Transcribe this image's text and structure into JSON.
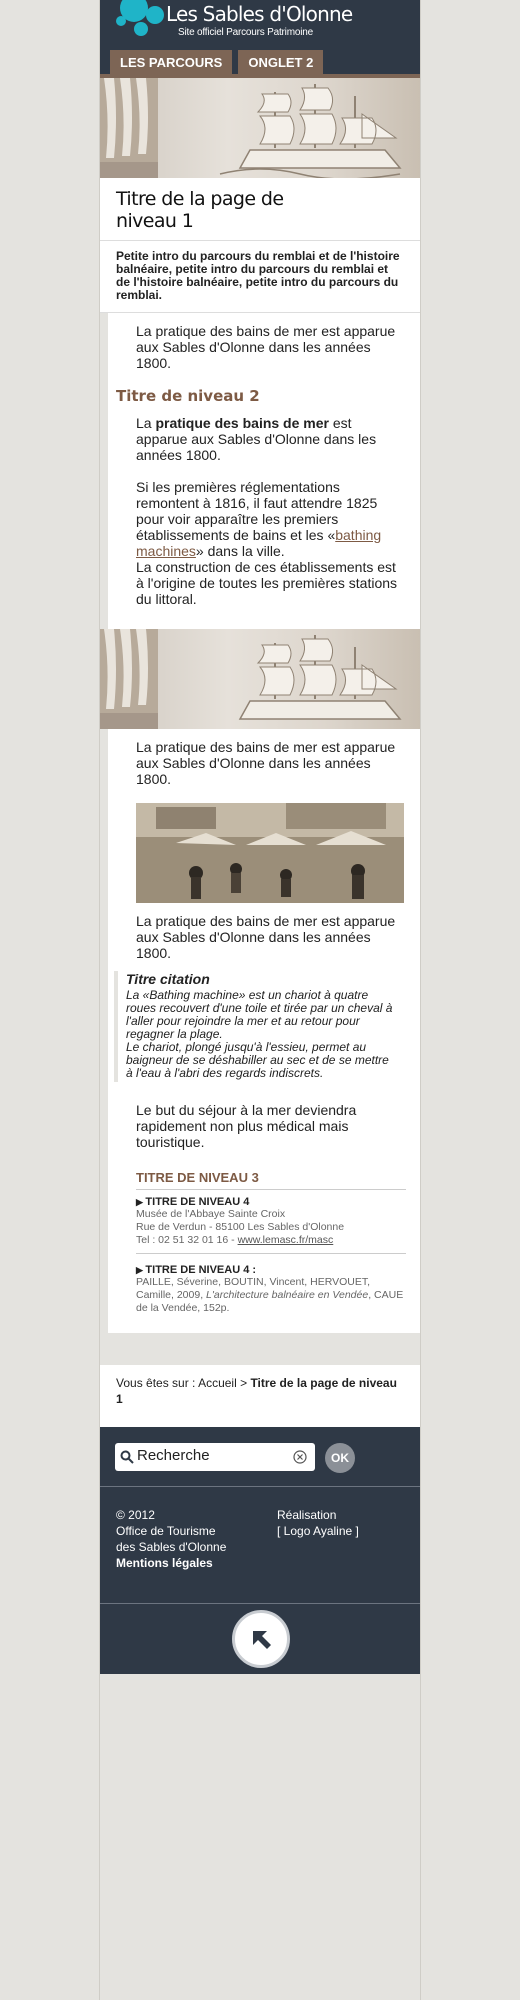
{
  "header": {
    "logo_title": "Les Sables d'Olonne",
    "logo_subtitle": "Site officiel Parcours Patrimoine",
    "tabs": [
      "LES PARCOURS",
      "ONGLET 2"
    ]
  },
  "page": {
    "title": "Titre de la page de niveau 1",
    "intro": "Petite intro du parcours du remblai et de l'histoire balnéaire, petite intro du parcours du remblai et de l'histoire balnéaire, petite intro du parcours du remblai."
  },
  "content": {
    "p1": "La pratique des bains de mer est apparue aux Sables d'Olonne dans les années 1800.",
    "h2": "Titre de niveau 2",
    "p2_prefix": "La ",
    "p2_bold": "pratique des bains de mer",
    "p2_suffix": " est apparue aux Sables d'Olonne dans les années 1800.",
    "p3_a": "Si les premières réglementations remontent à 1816, il faut attendre 1825 pour voir apparaître les premiers établissements de bains et les «",
    "p3_link": "bathing machines",
    "p3_b": "» dans la ville.",
    "p3_c": "La construction de ces établissements est à l'origine de toutes les premières stations du littoral.",
    "p4": "La pratique des bains de mer est apparue aux Sables d'Olonne dans les années 1800.",
    "p5": "La pratique des bains de mer est apparue aux Sables d'Olonne dans les années 1800.",
    "citation_title": "Titre citation",
    "citation_1": "La «Bathing machine» est un chariot à quatre roues recouvert d'une toile et tirée par un cheval à l'aller pour rejoindre la mer et au retour pour regagner la plage.",
    "citation_2": "Le chariot, plongé jusqu'à l'essieu, permet au baigneur de se déshabiller au sec et de se mettre à l'eau à l'abri des regards indiscrets.",
    "p6": "Le but du séjour à la mer deviendra rapidement non plus médical mais touristique.",
    "h3": "TITRE DE NIVEAU 3",
    "h4_a": "TITRE DE NIVEAU 4",
    "museum_name": "Musée de l'Abbaye Sainte Croix",
    "museum_address": "Rue de Verdun - 85100 Les Sables d'Olonne",
    "museum_tel": "Tel : 02 51 32 01 16 - ",
    "museum_link": "www.lemasc.fr/masc",
    "h4_b": "TITRE DE NIVEAU 4 :",
    "biblio_a": "PAILLE, Séverine, BOUTIN, Vincent, HERVOUET, Camille, 2009, ",
    "biblio_italic": "L'architecture balnéaire en Vendée",
    "biblio_b": ", CAUE de la Vendée, 152p."
  },
  "breadcrumb": {
    "prefix": "Vous êtes sur : ",
    "home": "Accueil",
    "separator": " > ",
    "current": "Titre de la page de niveau 1"
  },
  "search": {
    "value": "Recherche",
    "ok_label": "OK"
  },
  "footer": {
    "copyright": "© 2012",
    "org_line1": "Office de Tourisme",
    "org_line2": "des Sables d'Olonne",
    "legal": "Mentions légales",
    "realisation": "Réalisation",
    "logo_label": "[ Logo Ayaline ]"
  },
  "icons": {
    "search": "search-icon",
    "clear": "clear-icon",
    "back_to_top": "arrow-up-left-icon"
  },
  "colors": {
    "header_bg": "#2f3946",
    "accent_brown": "#7d5a44",
    "tab_bg": "#7d6555",
    "logo_cyan": "#1fb4c8",
    "page_bg": "#e4e3df"
  }
}
